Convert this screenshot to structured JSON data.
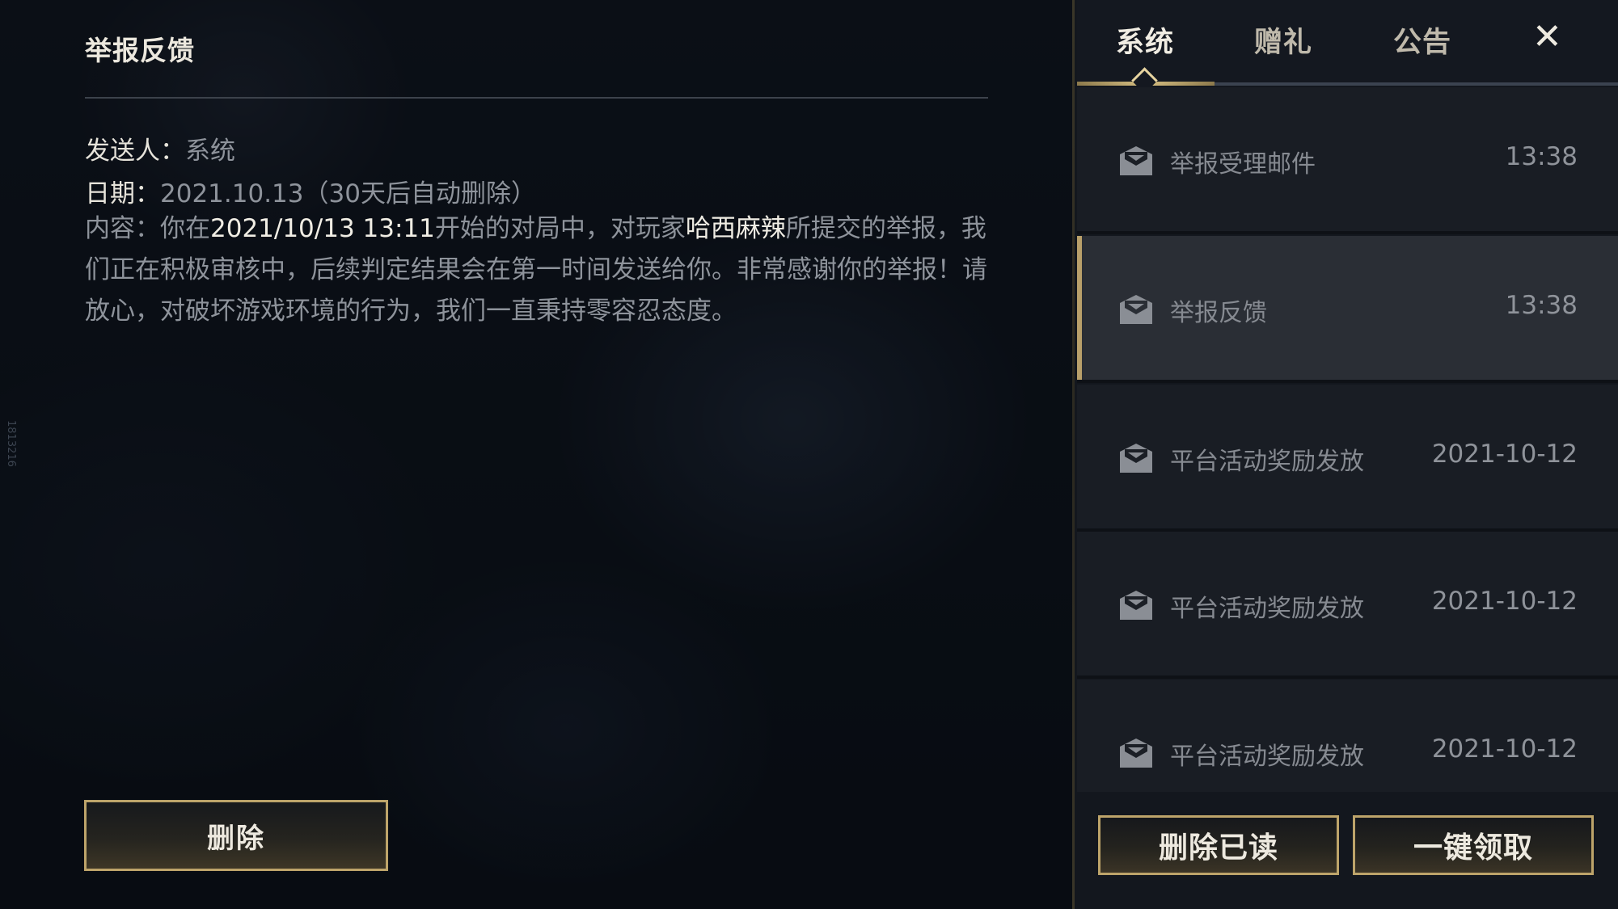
{
  "detail": {
    "title": "举报反馈",
    "sender_label": "发送人：",
    "sender_value": "系统",
    "date_label": "日期：",
    "date_value": "2021.10.13（30天后自动删除）",
    "content_label": "内容：",
    "content_1": "你在",
    "content_time": "2021/10/13 13:11",
    "content_2": "开始的对局中，对玩家",
    "content_player": "哈西麻辣",
    "content_3": "所提交的举报，我们正在积极审核中，后续判定结果会在第一时间发送给你。非常感谢你的举报！请放心，对破坏游戏环境的行为，我们一直秉持零容忍态度。",
    "delete_button": "删除"
  },
  "side_tag": "1813216",
  "tabs": {
    "system": "系统",
    "gift": "赠礼",
    "notice": "公告",
    "active": "system"
  },
  "close_icon": "close-icon",
  "mails": [
    {
      "subject": "举报受理邮件",
      "time": "13:38",
      "icon": "mail-icon"
    },
    {
      "subject": "举报反馈",
      "time": "13:38",
      "icon": "mail-icon",
      "selected": true
    },
    {
      "subject": "平台活动奖励发放",
      "time": "2021-10-12",
      "icon": "mail-icon"
    },
    {
      "subject": "平台活动奖励发放",
      "time": "2021-10-12",
      "icon": "mail-icon"
    },
    {
      "subject": "平台活动奖励发放",
      "time": "2021-10-12",
      "icon": "mail-icon"
    }
  ],
  "footer": {
    "delete_read": "删除已读",
    "claim_all": "一键领取"
  },
  "colors": {
    "gold": "#bda46a",
    "panel_bg": "#13171e",
    "selected_row": "#2a2e35"
  }
}
